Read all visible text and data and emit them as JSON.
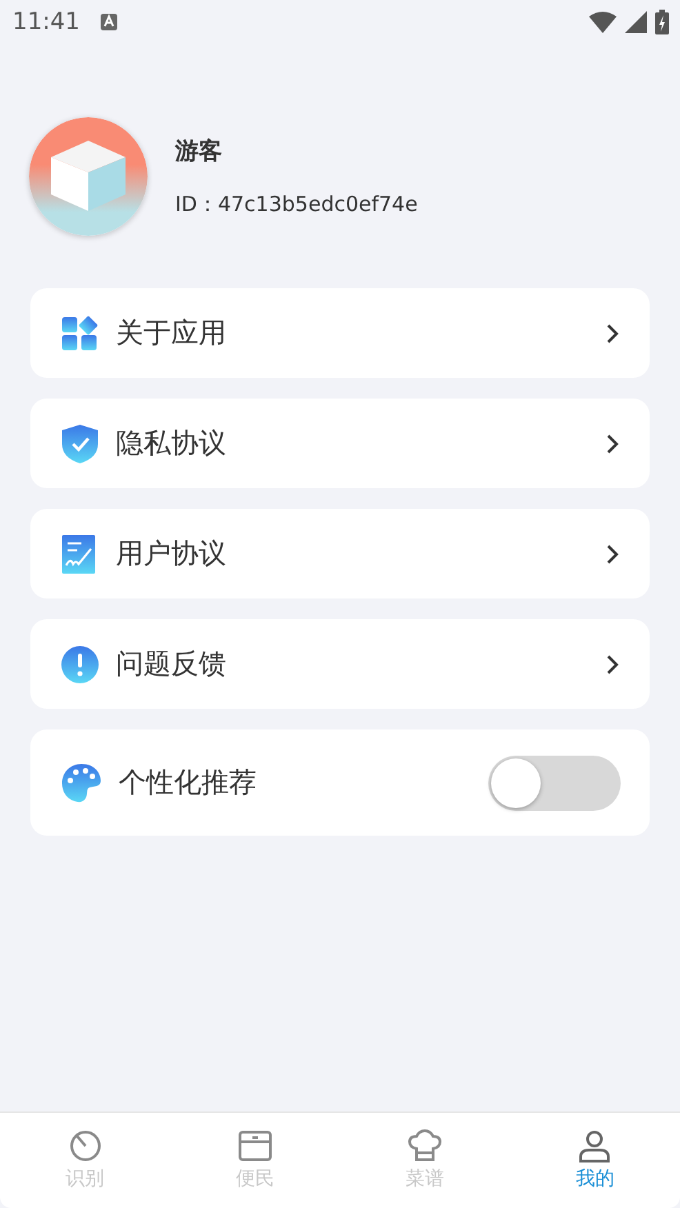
{
  "status_bar": {
    "time": "11:41"
  },
  "profile": {
    "name": "游客",
    "id": "ID：47c13b5edc0ef74e"
  },
  "menu": [
    {
      "kind": "link",
      "label": "关于应用"
    },
    {
      "kind": "link",
      "label": "隐私协议"
    },
    {
      "kind": "link",
      "label": "用户协议"
    },
    {
      "kind": "link",
      "label": "问题反馈"
    },
    {
      "kind": "toggle",
      "label": "个性化推荐",
      "on": false
    }
  ],
  "tabs": [
    {
      "label": "识别",
      "selected": false
    },
    {
      "label": "便民",
      "selected": false
    },
    {
      "label": "菜谱",
      "selected": false
    },
    {
      "label": "我的",
      "selected": true
    }
  ]
}
